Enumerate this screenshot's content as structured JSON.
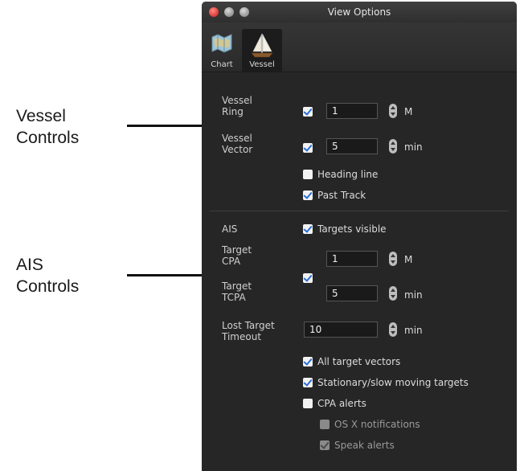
{
  "annotations": {
    "vessel_controls": [
      "Vessel",
      "Controls"
    ],
    "ais_controls": [
      "AIS",
      "Controls"
    ]
  },
  "window": {
    "title": "View Options"
  },
  "tabs": [
    {
      "label": "Chart",
      "icon": "chart-icon",
      "selected": false
    },
    {
      "label": "Vessel",
      "icon": "sailboat-icon",
      "selected": true
    }
  ],
  "vessel": {
    "ring": {
      "label": [
        "Vessel",
        "Ring"
      ],
      "checked": true,
      "value": "1",
      "unit": "M"
    },
    "vector": {
      "label": [
        "Vessel",
        "Vector"
      ],
      "checked": true,
      "value": "5",
      "unit": "min"
    },
    "heading_line": {
      "label": "Heading line",
      "checked": false
    },
    "past_track": {
      "label": "Past Track",
      "checked": true
    }
  },
  "ais": {
    "label": "AIS",
    "targets_visible": {
      "label": "Targets visible",
      "checked": true
    },
    "target_cpa": {
      "label": [
        "Target",
        "CPA"
      ],
      "value": "1",
      "unit": "M"
    },
    "target_tcpa": {
      "label": [
        "Target",
        "TCPA"
      ],
      "value": "5",
      "unit": "min"
    },
    "cpa_tcpa_checked": true,
    "lost_target_timeout": {
      "label": [
        "Lost Target",
        "Timeout"
      ],
      "value": "10",
      "unit": "min"
    },
    "all_target_vectors": {
      "label": "All target vectors",
      "checked": true
    },
    "stationary": {
      "label": "Stationary/slow moving targets",
      "checked": true
    },
    "cpa_alerts": {
      "label": "CPA alerts",
      "checked": false
    },
    "osx_notifications": {
      "label": "OS X notifications",
      "checked": false,
      "enabled": false
    },
    "speak_alerts": {
      "label": "Speak alerts",
      "checked": true,
      "enabled": false
    }
  },
  "colors": {
    "window_bg": "#262626",
    "checkbox_accent": "#2a6fd6"
  }
}
